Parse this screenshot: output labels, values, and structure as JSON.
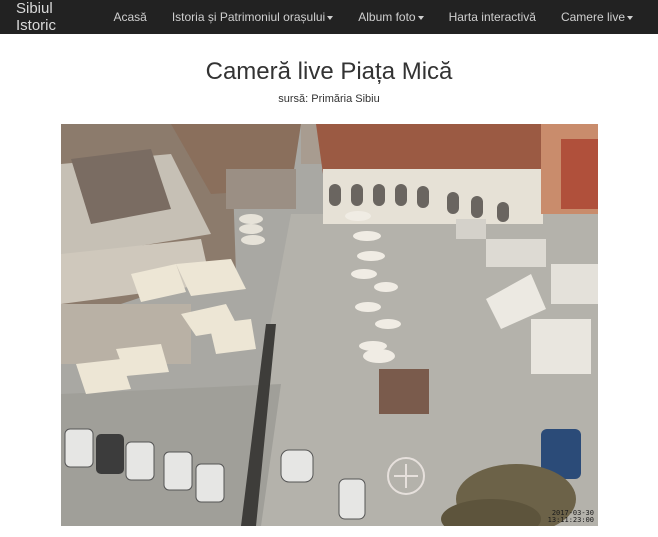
{
  "navbar": {
    "brand": "Sibiul Istoric",
    "items": [
      {
        "label": "Acasă",
        "dropdown": false
      },
      {
        "label": "Istoria și Patrimoniul orașului",
        "dropdown": true
      },
      {
        "label": "Album foto",
        "dropdown": true
      },
      {
        "label": "Harta interactivă",
        "dropdown": false
      },
      {
        "label": "Camere live",
        "dropdown": true
      }
    ]
  },
  "page": {
    "title": "Cameră live Piața Mică",
    "source": "sursă: Primăria Sibiu"
  },
  "camera": {
    "timestamp_date": "2017-03-30",
    "timestamp_time": "13:11:23:00"
  },
  "colors": {
    "navbar_bg": "#222222",
    "nav_text": "#cfcfcf"
  }
}
